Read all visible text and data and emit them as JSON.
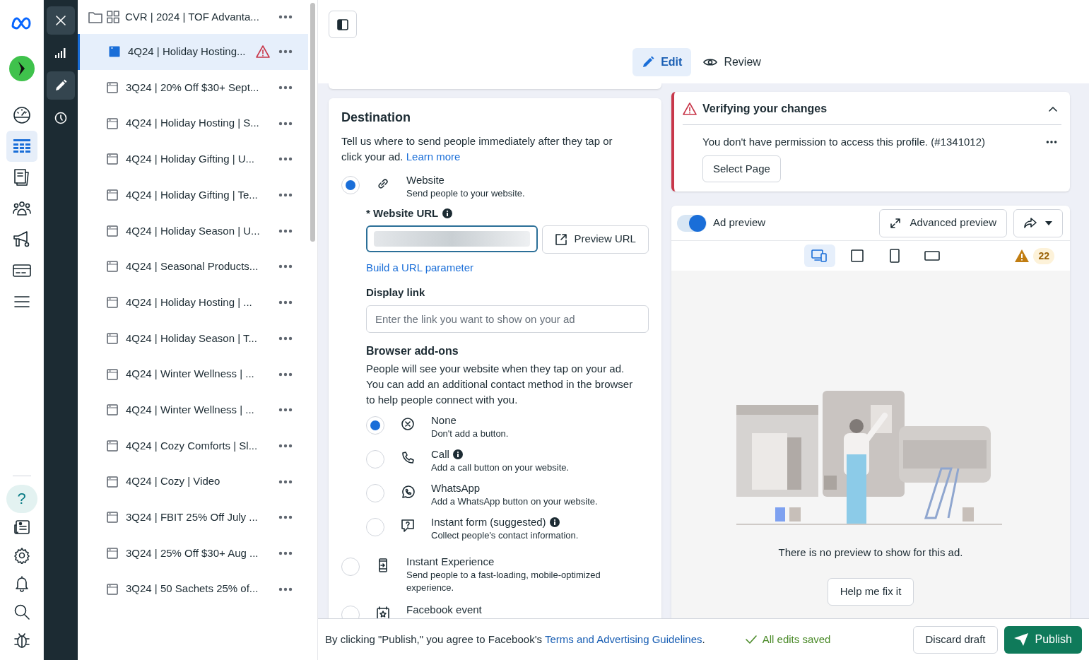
{
  "nav_rail": {
    "top": [
      {
        "kind": "logo",
        "selected": false
      },
      {
        "kind": "avatar",
        "selected": false
      },
      {
        "kind": "gauge",
        "selected": false
      },
      {
        "kind": "table",
        "selected": true
      },
      {
        "kind": "pages",
        "selected": false
      },
      {
        "kind": "people",
        "selected": false
      },
      {
        "kind": "megaphone",
        "selected": false
      },
      {
        "kind": "card",
        "selected": false
      },
      {
        "kind": "menu",
        "selected": false
      }
    ],
    "bottom": [
      {
        "kind": "help",
        "label": "?",
        "selected": true
      },
      {
        "kind": "news",
        "selected": false
      },
      {
        "kind": "gear",
        "selected": false
      },
      {
        "kind": "bell",
        "selected": false
      },
      {
        "kind": "search",
        "selected": false
      },
      {
        "kind": "bug",
        "selected": false
      }
    ]
  },
  "tool_rail": [
    {
      "kind": "close",
      "selected": true
    },
    {
      "kind": "chart",
      "selected": false
    },
    {
      "kind": "edit",
      "selected": true
    },
    {
      "kind": "history",
      "selected": false
    }
  ],
  "tree": {
    "label": "CVR | 2024 | TOF Advanta...",
    "children": [
      {
        "label": "4Q24 | Holiday Hosting...",
        "selected": true,
        "warning": true
      },
      {
        "label": "3Q24 | 20% Off $30+ Sept...",
        "selected": false,
        "warning": false
      },
      {
        "label": "4Q24 | Holiday Hosting | S...",
        "selected": false,
        "warning": false
      },
      {
        "label": "4Q24 | Holiday Gifting | U...",
        "selected": false,
        "warning": false
      },
      {
        "label": "4Q24 | Holiday Gifting | Te...",
        "selected": false,
        "warning": false
      },
      {
        "label": "4Q24 | Holiday Season | U...",
        "selected": false,
        "warning": false
      },
      {
        "label": "4Q24 | Seasonal Products...",
        "selected": false,
        "warning": false
      },
      {
        "label": "4Q24 | Holiday Hosting | ...",
        "selected": false,
        "warning": false
      },
      {
        "label": "4Q24 | Holiday Season | T...",
        "selected": false,
        "warning": false
      },
      {
        "label": "4Q24 | Winter Wellness | ...",
        "selected": false,
        "warning": false
      },
      {
        "label": "4Q24 | Winter Wellness | ...",
        "selected": false,
        "warning": false
      },
      {
        "label": "4Q24 | Cozy Comforts | Sl...",
        "selected": false,
        "warning": false
      },
      {
        "label": "4Q24 | Cozy | Video",
        "selected": false,
        "warning": false
      },
      {
        "label": "3Q24 | FBIT 25% Off July ...",
        "selected": false,
        "warning": false
      },
      {
        "label": "3Q24 | 25% Off $30+ Aug ...",
        "selected": false,
        "warning": false
      },
      {
        "label": "3Q24 | 50 Sachets 25% of...",
        "selected": false,
        "warning": false
      }
    ]
  },
  "mode_tabs": [
    {
      "label": "Edit",
      "kind": "edit",
      "selected": true
    },
    {
      "label": "Review",
      "kind": "review",
      "selected": false
    }
  ],
  "destination": {
    "title": "Destination",
    "description": "Tell us where to send people immediately after they tap or click your ad.",
    "learn_more": "Learn more",
    "options": [
      {
        "kind": "website",
        "title": "Website",
        "description": "Send people to your website.",
        "selected": true
      },
      {
        "kind": "instant_experience",
        "title": "Instant Experience",
        "description": "Send people to a fast-loading, mobile-optimized experience.",
        "selected": false
      },
      {
        "kind": "event",
        "title": "Facebook event",
        "selected": false
      }
    ],
    "website_url": {
      "label": "* Website URL",
      "info": true,
      "button": "Preview URL"
    },
    "url_parameter_link": "Build a URL parameter",
    "display_link": {
      "label": "Display link",
      "placeholder": "Enter the link you want to show on your ad"
    },
    "addons": {
      "title": "Browser add-ons",
      "description": "People will see your website when they tap on your ad. You can add an additional contact method in the browser to help people connect with you.",
      "options": [
        {
          "kind": "none",
          "title": "None",
          "description": "Don't add a button.",
          "info": false,
          "selected": true
        },
        {
          "kind": "call",
          "title": "Call",
          "description": "Add a call button on your website.",
          "info": true,
          "selected": false
        },
        {
          "kind": "whatsapp",
          "title": "WhatsApp",
          "description": "Add a WhatsApp button on your website.",
          "info": false,
          "selected": false
        },
        {
          "kind": "form",
          "title": "Instant form (suggested)",
          "description": "Collect people's contact information.",
          "info": true,
          "selected": false
        }
      ]
    }
  },
  "verification": {
    "title": "Verifying your changes",
    "expanded": true,
    "message": "You don't have permission to access this profile. (#1341012)",
    "button": "Select Page"
  },
  "preview": {
    "toggle_label": "Ad preview",
    "on": true,
    "advanced_button": "Advanced preview",
    "devices": [
      {
        "kind": "multi",
        "selected": true
      },
      {
        "kind": "square",
        "selected": false
      },
      {
        "kind": "portrait",
        "selected": false
      },
      {
        "kind": "landscape",
        "selected": false
      }
    ],
    "warning_count": "22",
    "empty_message": "There is no preview to show for this ad.",
    "fix_button": "Help me fix it"
  },
  "footer": {
    "terms_before": "By clicking \"Publish,\" you agree to Facebook's",
    "terms_link": "Terms and Advertising Guidelines",
    "terms_after": ".",
    "saved": "All edits saved",
    "discard_button": "Discard draft",
    "publish_button": "Publish"
  }
}
